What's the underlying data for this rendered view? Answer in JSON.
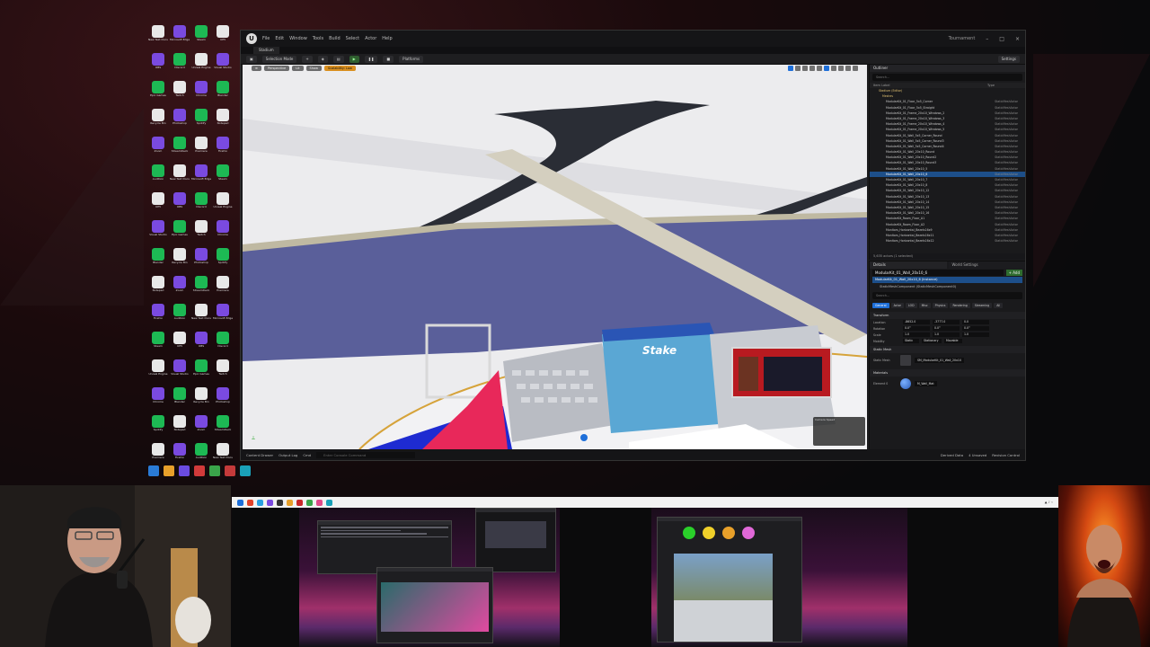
{
  "editor": {
    "menu": [
      "File",
      "Edit",
      "Window",
      "Tools",
      "Build",
      "Select",
      "Actor",
      "Help"
    ],
    "project_name": "Tournament",
    "map_tab": "Stadium",
    "toolbar": {
      "selection_mode": "Selection Mode",
      "platforms": "Platforms",
      "settings": "Settings"
    },
    "viewport": {
      "perspective": "Perspective",
      "lit": "Lit",
      "show": "Show",
      "scalability": "Scalability: Low",
      "hud_title": "Camera Speed"
    },
    "outliner": {
      "tab": "Outliner",
      "search_placeholder": "Search...",
      "col_label": "Item Label",
      "col_type": "Type",
      "folders": [
        "Stadium (Editor)",
        "Meshes"
      ],
      "rows": [
        "ModularKit_01_Floor_5x5_Corner",
        "ModularKit_01_Floor_5x5_Straight",
        "ModularKit_01_Frame_20x10_Windows_2",
        "ModularKit_01_Frame_20x10_Windows_3",
        "ModularKit_01_Frame_20x10_Windows_4",
        "ModularKit_01_Frame_20x10_Windows_5",
        "ModularKit_01_Wall_5x5_Corner_Round",
        "ModularKit_01_Wall_5x5_Corner_Round3",
        "ModularKit_01_Wall_5x5_Corner_Round4",
        "ModularKit_01_Wall_20x10_Round",
        "ModularKit_01_Wall_20x10_Round2",
        "ModularKit_01_Wall_20x10_Round3",
        "ModularKit_01_Wall_20x10_5",
        "ModularKit_01_Wall_20x10_6",
        "ModularKit_01_Wall_20x10_7",
        "ModularKit_01_Wall_20x10_8",
        "ModularKit_01_Wall_20x10_12",
        "ModularKit_01_Wall_20x10_13",
        "ModularKit_01_Wall_20x10_14",
        "ModularKit_01_Wall_20x10_15",
        "ModularKit_01_Wall_20x10_16",
        "ModularKit_Room_Floor_A1",
        "ModularKit_Room_Floor_A2",
        "Monitors_Horizontal_Bezels16x9",
        "Monitors_Horizontal_Bezels16x11",
        "Monitors_Horizontal_Bezels16x12"
      ],
      "row_type": "StaticMeshActor",
      "selected_index": 13,
      "count": "5,635 actors (1 selected)"
    },
    "details": {
      "tabs": [
        "Details",
        "World Settings"
      ],
      "actor_name": "ModularKit_01_Wall_20x10_6",
      "add_label": "+ Add",
      "component": "ModularKit_01_Wall_20x10_6 (Instance)",
      "sub_component": "StaticMeshComponent (StaticMeshComponent0)",
      "filter_tabs": [
        "General",
        "Actor",
        "LOD",
        "Misc",
        "Physics",
        "Rendering",
        "Streaming",
        "All"
      ],
      "sections": [
        "Transform",
        "Static Mesh",
        "Materials"
      ],
      "props": [
        {
          "label": "Location",
          "x": "-8652.0",
          "y": "-3777.0",
          "z": "0.0"
        },
        {
          "label": "Rotation",
          "x": "0.0°",
          "y": "0.0°",
          "z": "0.0°"
        },
        {
          "label": "Scale",
          "x": "1.0",
          "y": "1.0",
          "z": "1.0"
        }
      ],
      "mobility_label": "Mobility",
      "mobility_options": [
        "Static",
        "Stationary",
        "Movable"
      ],
      "static_mesh_label": "Static Mesh",
      "static_mesh_value": "SM_ModularKit_01_Wall_20x10",
      "element_label": "Element 0",
      "element_value": "M_Wall_Mat"
    },
    "bottom": {
      "content_drawer": "Content Drawer",
      "output_log": "Output Log",
      "cmd": "Cmd",
      "cmd_placeholder": "Enter Console Command",
      "derived_data": "Derived Data",
      "unsaved": "4 Unsaved",
      "revision": "Revision Control"
    }
  },
  "desktop_icons": [
    "New Text Document",
    "Microsoft Edge",
    "Steam",
    "UE5",
    "OBS",
    "Discord",
    "Unreal Engine",
    "Visual Studio",
    "Epic Games",
    "Twitch",
    "Chrome",
    "Blender",
    "Recycle Bin",
    "Photoshop",
    "Spotify",
    "Notepad",
    "Zoom",
    "StreamDeck",
    "Premiere",
    "Firefox",
    "Audition"
  ],
  "colors": {
    "accent_blue": "#1e6fd9",
    "select_blue": "#1d4f8a",
    "stadium_blue": "#5a5f9a",
    "stadium_pink": "#e8285a",
    "scalability_orange": "#d98f1f"
  }
}
